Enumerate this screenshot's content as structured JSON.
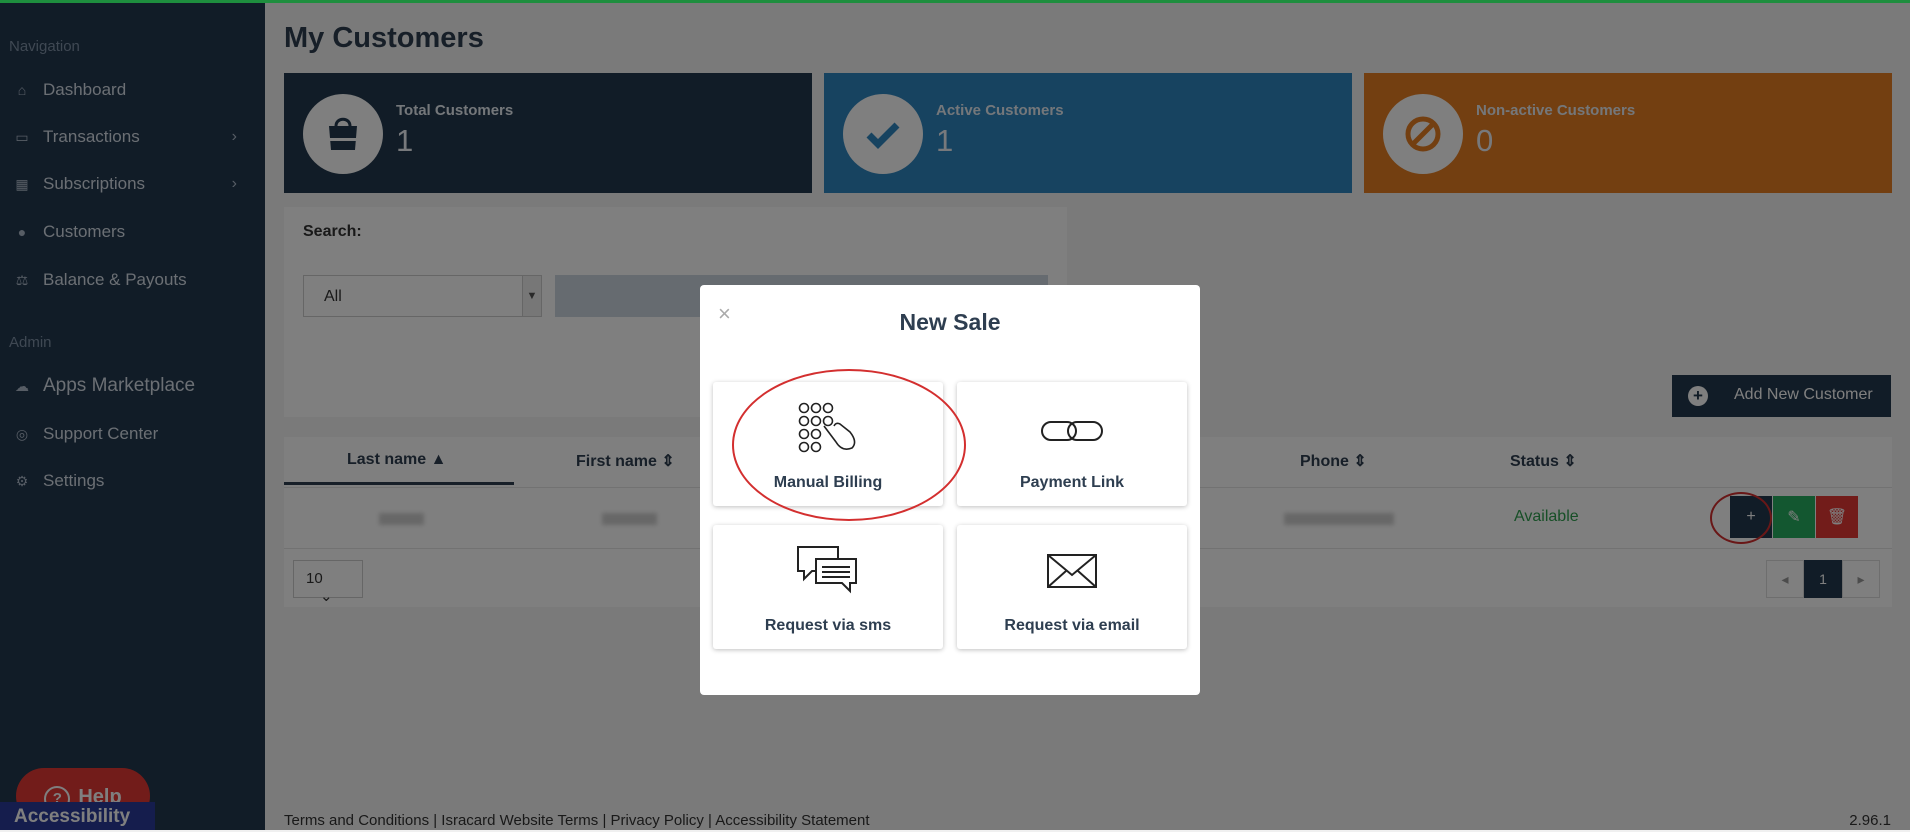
{
  "sidebar": {
    "nav_heading": "Navigation",
    "admin_heading": "Admin",
    "items": [
      {
        "label": "Dashboard",
        "icon": "home-icon"
      },
      {
        "label": "Transactions",
        "icon": "money-icon"
      },
      {
        "label": "Subscriptions",
        "icon": "calendar-icon"
      },
      {
        "label": "Customers",
        "icon": "users-icon"
      },
      {
        "label": "Balance & Payouts",
        "icon": "scale-icon"
      }
    ],
    "admin_items": [
      {
        "label": "Apps Marketplace",
        "icon": "cloud-icon"
      },
      {
        "label": "Support Center",
        "icon": "lifebuoy-icon"
      },
      {
        "label": "Settings",
        "icon": "gear-icon"
      }
    ],
    "help_label": "Help",
    "accessibility_label": "Accessibility"
  },
  "main": {
    "title": "My Customers",
    "stats": [
      {
        "label": "Total Customers",
        "value": "1",
        "color": "#22384e"
      },
      {
        "label": "Active Customers",
        "value": "1",
        "color": "#2e86c1"
      },
      {
        "label": "Non-active Customers",
        "value": "0",
        "color": "#e67e22"
      }
    ],
    "search_label": "Search:",
    "filter_value": "All",
    "add_button": "Add New Customer",
    "columns": [
      "Last name",
      "First name",
      "Phone",
      "Status"
    ],
    "row_status": "Available",
    "page_size": "10",
    "current_page": "1",
    "footer_links": "Terms and Conditions   |   Isracard Website Terms   |   Privacy Policy   |   Accessibility Statement",
    "version": "2.96.1"
  },
  "modal": {
    "title": "New Sale",
    "close": "×",
    "options": [
      {
        "label": "Manual Billing",
        "icon": "keypad-hand-icon"
      },
      {
        "label": "Payment Link",
        "icon": "link-icon"
      },
      {
        "label": "Request via sms",
        "icon": "chat-icon"
      },
      {
        "label": "Request via email",
        "icon": "envelope-icon"
      }
    ]
  }
}
